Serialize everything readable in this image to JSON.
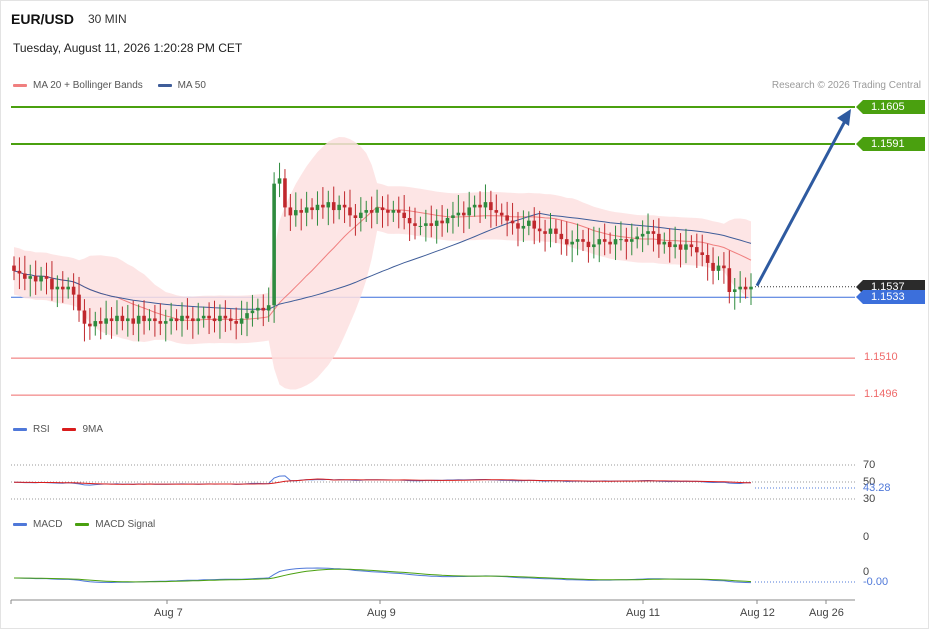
{
  "header": {
    "symbol": "EUR/USD",
    "interval": "30 MIN",
    "datetime": "Tuesday, August 11, 2026 1:20:28 PM CET",
    "credit": "Research © 2026 Trading Central"
  },
  "colors": {
    "ma20": "#f07f7f",
    "band": "#fde0e0",
    "ma50": "#3f5d99",
    "up_candle": "#2e8b3e",
    "down_candle": "#c0282d",
    "green_level": "#4aa00f",
    "blue_level": "#3c6fdb",
    "red_level": "#ef6a6a",
    "current_price": "#2b2b2b",
    "arrow": "#2e5aa0",
    "rsi": "#4f78d9",
    "rsi_ma": "#d91c1c",
    "macd": "#4f78d9",
    "macd_signal": "#4aa00f"
  },
  "legend_main": [
    {
      "label": "MA 20 + Bollinger Bands",
      "color": "#f07f7f"
    },
    {
      "label": "MA 50",
      "color": "#3f5d99"
    }
  ],
  "legend_rsi": [
    {
      "label": "RSI",
      "color": "#4f78d9"
    },
    {
      "label": "9MA",
      "color": "#d91c1c"
    }
  ],
  "legend_macd": [
    {
      "label": "MACD",
      "color": "#4f78d9"
    },
    {
      "label": "MACD Signal",
      "color": "#4aa00f"
    }
  ],
  "chart_data": {
    "type": "candlestick",
    "title": "EUR/USD 30 MIN",
    "x_tick_labels": [
      "Aug 7",
      "Aug 9",
      "Aug 11",
      "Aug 12",
      "Aug 26"
    ],
    "price_levels": [
      {
        "label": "1.1605",
        "value": 1.1605,
        "kind": "resistance"
      },
      {
        "label": "1.1591",
        "value": 1.1591,
        "kind": "resistance"
      },
      {
        "label": "1.1537",
        "value": 1.1537,
        "kind": "current_price"
      },
      {
        "label": "1.1533",
        "value": 1.1533,
        "kind": "pivot"
      },
      {
        "label": "1.1510",
        "value": 1.151,
        "kind": "support"
      },
      {
        "label": "1.1496",
        "value": 1.1496,
        "kind": "support"
      }
    ],
    "projection": {
      "from": 1.1537,
      "to": 1.1605,
      "direction": "up"
    },
    "close_series": [
      1.1543,
      1.1542,
      1.154,
      1.1541,
      1.1539,
      1.1541,
      1.154,
      1.1536,
      1.1537,
      1.1536,
      1.1537,
      1.1534,
      1.1528,
      1.1523,
      1.1522,
      1.1524,
      1.1523,
      1.1525,
      1.1524,
      1.1526,
      1.1524,
      1.1525,
      1.1523,
      1.1526,
      1.1524,
      1.1525,
      1.1524,
      1.1523,
      1.1524,
      1.1525,
      1.1524,
      1.1526,
      1.1525,
      1.1524,
      1.1525,
      1.1526,
      1.1525,
      1.1524,
      1.1526,
      1.1525,
      1.1524,
      1.1523,
      1.1525,
      1.1527,
      1.1528,
      1.1529,
      1.1528,
      1.153,
      1.1576,
      1.1578,
      1.1567,
      1.1564,
      1.1566,
      1.1565,
      1.1567,
      1.1566,
      1.1568,
      1.1567,
      1.1569,
      1.1566,
      1.1568,
      1.1567,
      1.1564,
      1.1563,
      1.1565,
      1.1566,
      1.1565,
      1.1567,
      1.1566,
      1.1565,
      1.1566,
      1.1565,
      1.1563,
      1.1561,
      1.156,
      1.156,
      1.1561,
      1.156,
      1.1562,
      1.1561,
      1.1563,
      1.1564,
      1.1565,
      1.1564,
      1.1567,
      1.1568,
      1.1567,
      1.1569,
      1.1566,
      1.1565,
      1.1564,
      1.1562,
      1.1561,
      1.1559,
      1.156,
      1.1562,
      1.1559,
      1.1558,
      1.1557,
      1.1559,
      1.1557,
      1.1555,
      1.1553,
      1.1554,
      1.1555,
      1.1554,
      1.1552,
      1.1553,
      1.1555,
      1.1554,
      1.1553,
      1.1555,
      1.1555,
      1.1554,
      1.1555,
      1.1556,
      1.1557,
      1.1558,
      1.1557,
      1.1553,
      1.1554,
      1.1552,
      1.1553,
      1.1551,
      1.1553,
      1.1552,
      1.155,
      1.1549,
      1.1546,
      1.1543,
      1.1545,
      1.1544,
      1.1535,
      1.1536,
      1.1537,
      1.1536,
      1.1537
    ],
    "ma20_last": 1.1541,
    "ma50_last": 1.1545,
    "rsi": {
      "tick_labels": [
        "70",
        "50",
        "30"
      ],
      "last_label": "43.28",
      "last_value": 43.28
    },
    "macd": {
      "tick_labels": [
        "0",
        "0"
      ],
      "last_label": "-0.00",
      "last_value": -0.0
    }
  }
}
